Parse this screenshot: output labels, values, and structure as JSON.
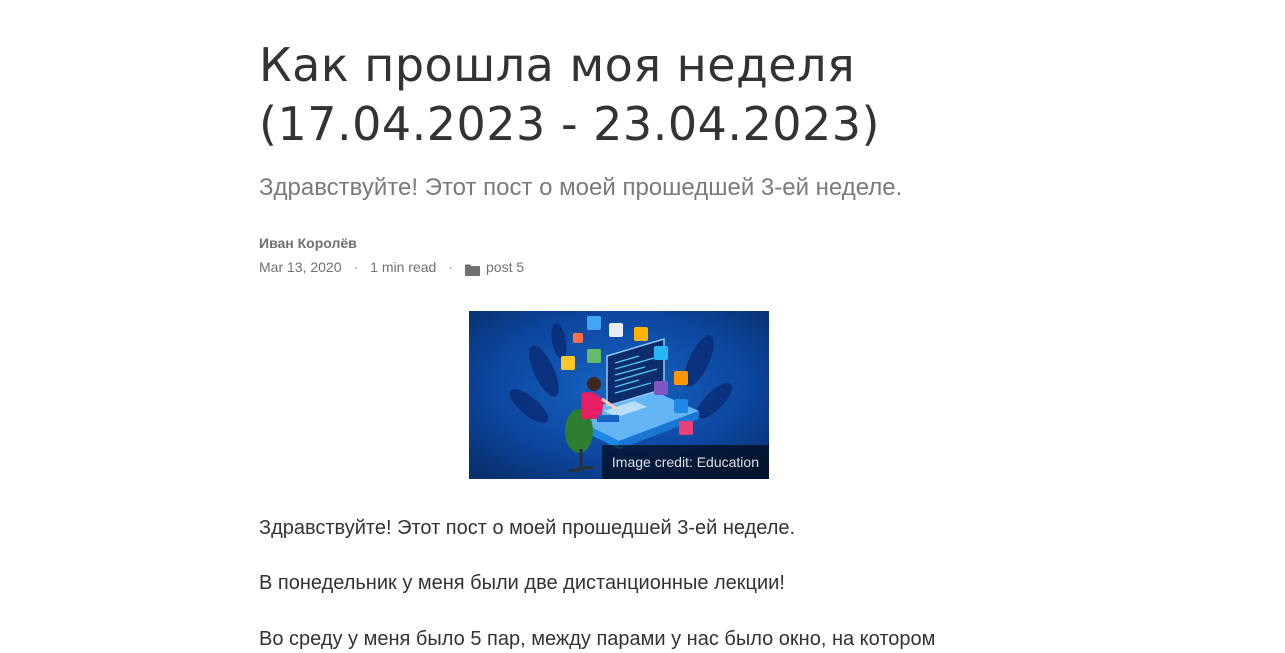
{
  "post": {
    "title_line1": "Как прошла моя неделя",
    "title_line2": "(17.04.2023 - 23.04.2023)",
    "subtitle": "Здравствуйте! Этот пост о моей прошедшей 3-ей неделе.",
    "author": "Иван Королёв",
    "date": "Mar 13, 2020",
    "separator": "·",
    "read_time": "1 min read",
    "category": "post 5",
    "category_icon": "folder-icon"
  },
  "image": {
    "caption": "Image credit: Education",
    "colors": {
      "background": "#0b3d91",
      "accent": "#e91e63"
    }
  },
  "body": {
    "paragraphs": [
      "Здравствуйте! Этот пост о моей прошедшей 3-ей неделе.",
      "В понедельник у меня были две дистанционные лекции!",
      "Во среду у меня было 5 пар, между парами у нас было окно, на котором"
    ]
  }
}
